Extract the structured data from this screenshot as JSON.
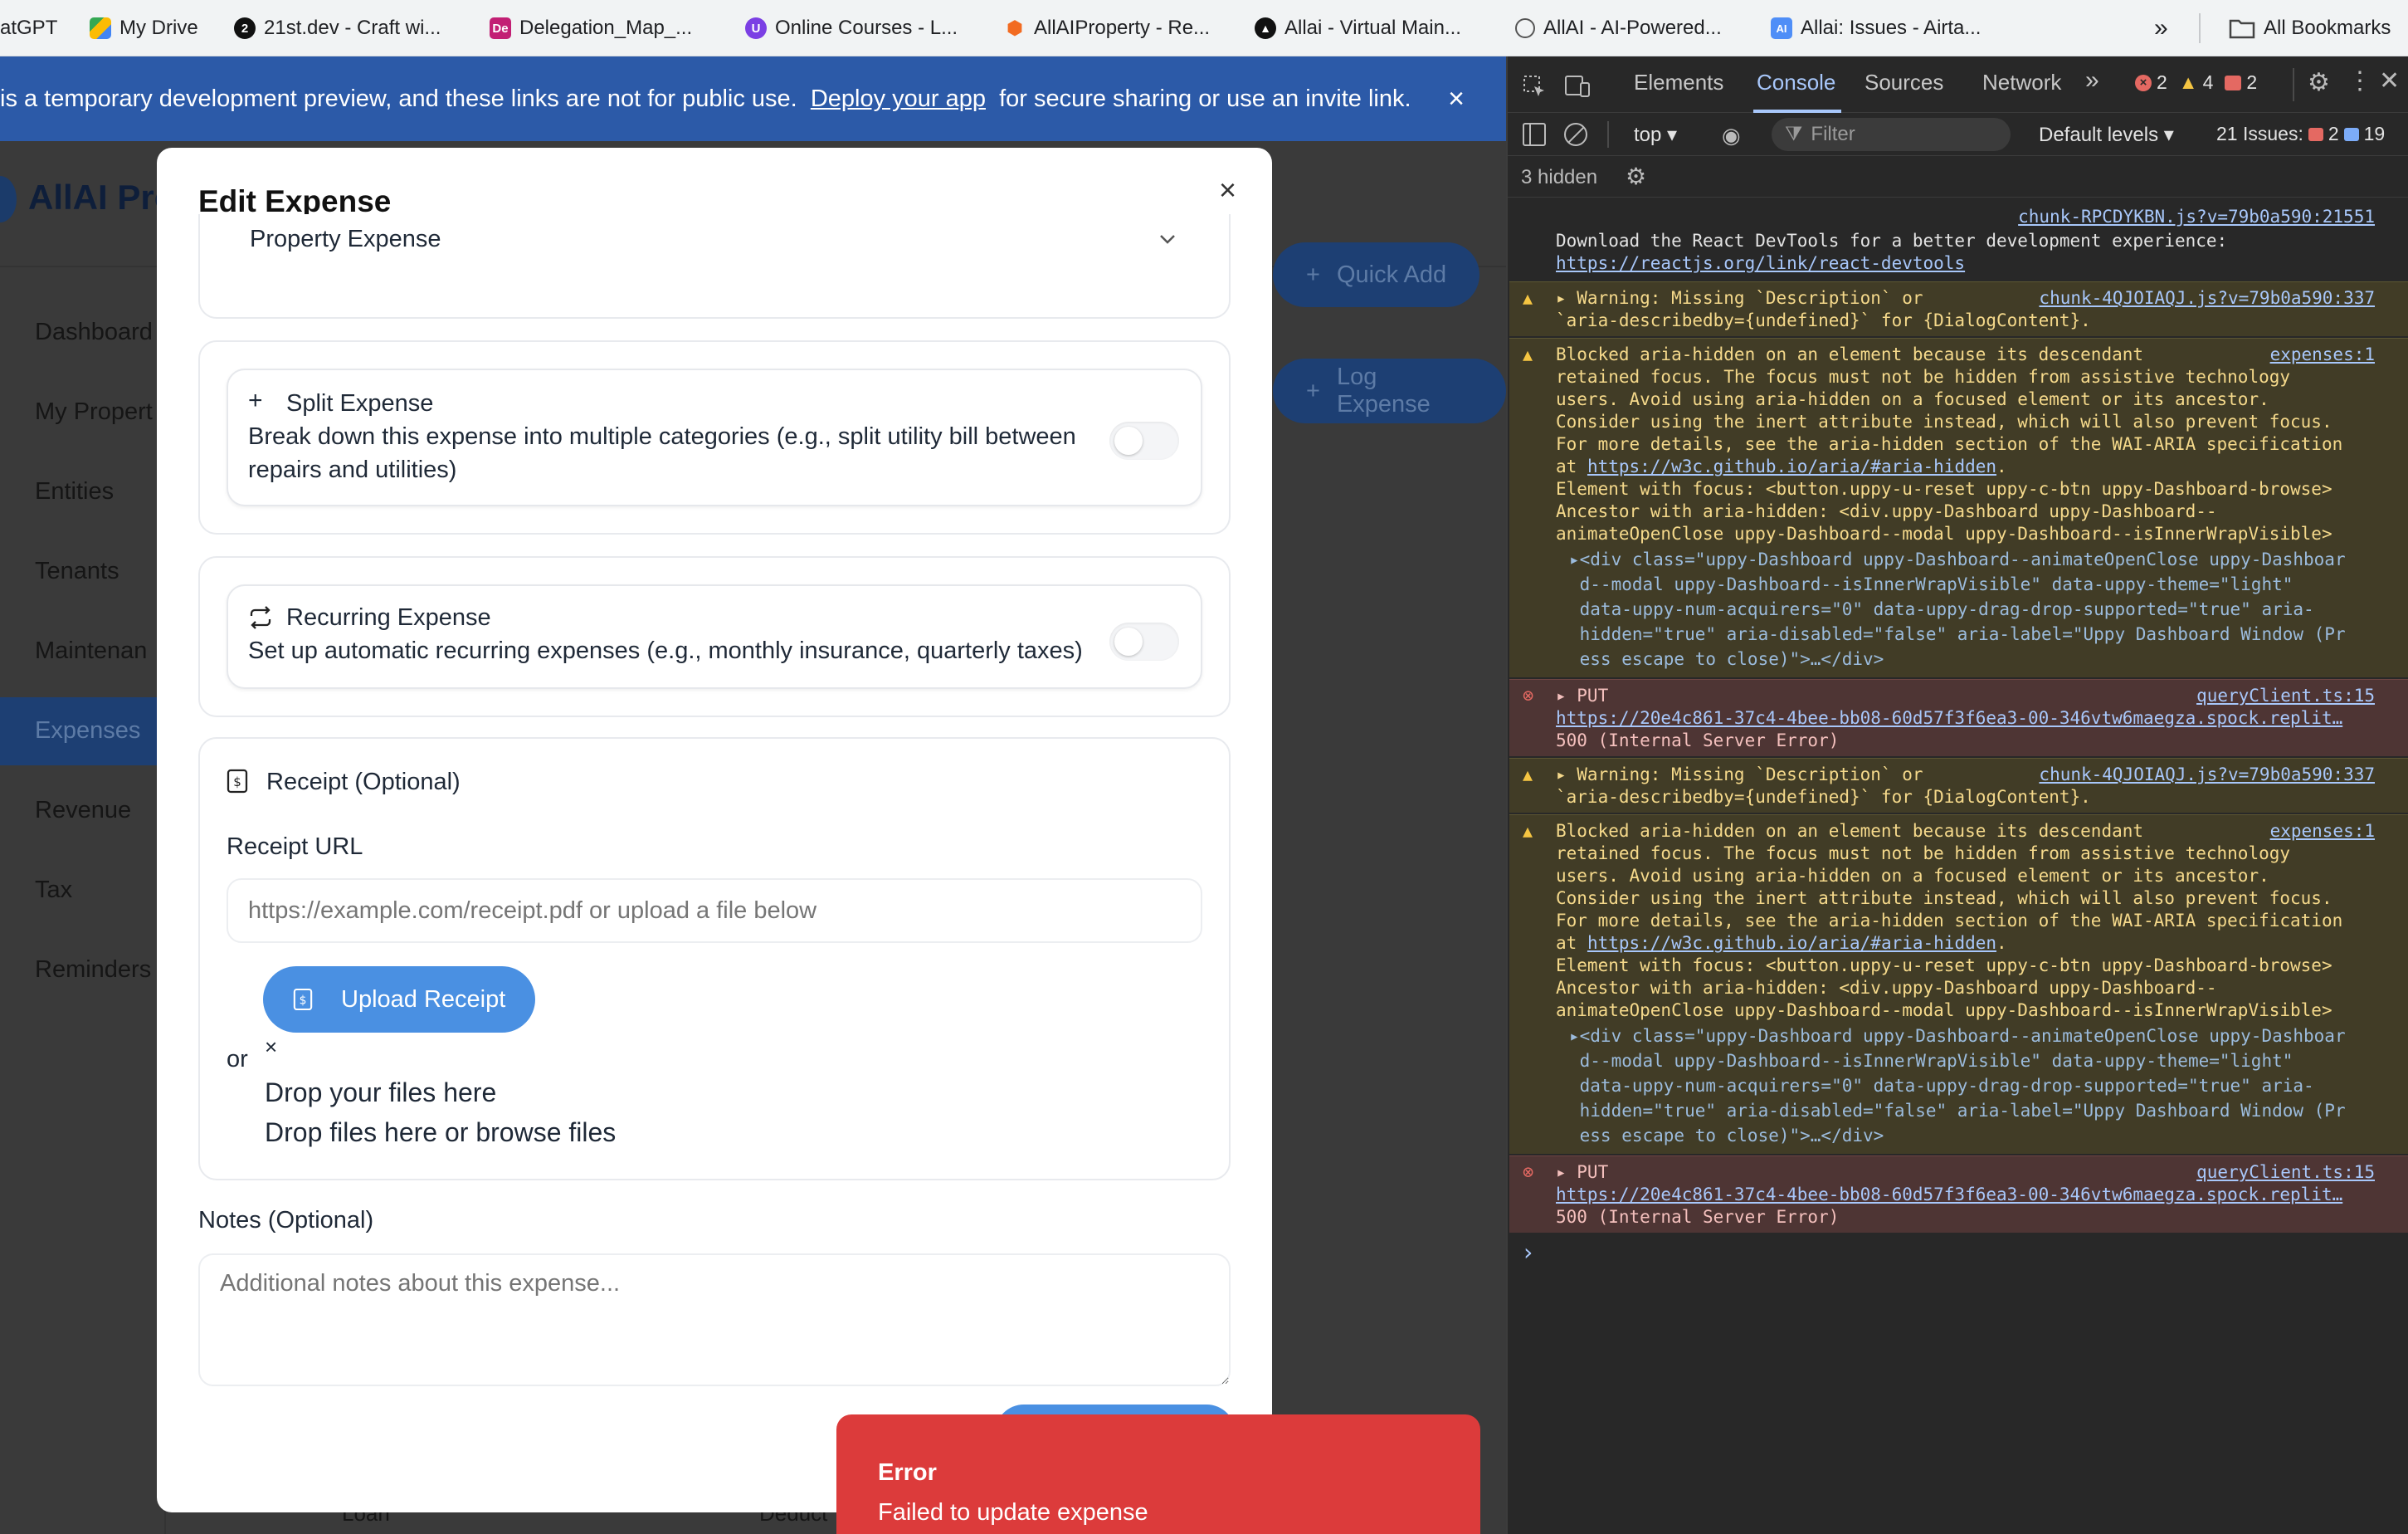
{
  "bookmarks": [
    {
      "label": "ChatGPT",
      "display": "atGPT"
    },
    {
      "label": "My Drive"
    },
    {
      "label": "21st.dev - Craft wi..."
    },
    {
      "label": "Delegation_Map_..."
    },
    {
      "label": "Online Courses - L..."
    },
    {
      "label": "AllAIProperty - Re..."
    },
    {
      "label": "Allai - Virtual Main..."
    },
    {
      "label": "AllAI - AI-Powered..."
    },
    {
      "label": "Allai: Issues - Airta..."
    }
  ],
  "bookmarks_more": "»",
  "all_bookmarks": "All Bookmarks",
  "banner": {
    "prefix": "is a temporary development preview, and these links are not for public use.",
    "link": "Deploy your app",
    "suffix": "for secure sharing or use an invite link.",
    "close": "×"
  },
  "app": {
    "title": "AllAI Pro",
    "quick_add": "Quick Add",
    "log_expense": "Log Expense",
    "nav": [
      "Dashboard",
      "My Propert",
      "Entities",
      "Tenants",
      "Maintenan",
      "Expenses",
      "Revenue",
      "Tax",
      "Reminders"
    ],
    "bottom_left": "Loan",
    "bottom_right": "Deduct"
  },
  "modal": {
    "title": "Edit Expense",
    "close": "×",
    "category_value": "Property Expense",
    "split": {
      "title": "Split Expense",
      "desc_line1": "Break down this expense into multiple categories (e.g., split utility bill between",
      "desc_line2": "repairs and utilities)",
      "enabled": false
    },
    "recurring": {
      "title": "Recurring Expense",
      "desc": "Set up automatic recurring expenses (e.g., monthly insurance, quarterly taxes)",
      "enabled": false
    },
    "receipt": {
      "title": "Receipt (Optional)",
      "url_label": "Receipt URL",
      "url_placeholder": "https://example.com/receipt.pdf or upload a file below",
      "upload_button": "Upload Receipt",
      "or": "or",
      "x": "×",
      "drop1": "Drop your files here",
      "drop2": "Drop files here or browse files"
    },
    "notes": {
      "label": "Notes (Optional)",
      "placeholder": "Additional notes about this expense..."
    }
  },
  "toast": {
    "title": "Error",
    "message": "Failed to update expense"
  },
  "devtools": {
    "tabs": [
      "Elements",
      "Console",
      "Sources",
      "Network"
    ],
    "active_tab": "Console",
    "more": "»",
    "errors": "2",
    "warnings": "4",
    "issues_badge": "2",
    "context": "top",
    "filter_placeholder": "Filter",
    "levels": "Default levels",
    "issues_label": "21 Issues:",
    "issues_err": "2",
    "issues_info": "19",
    "hidden": "3 hidden",
    "messages": [
      {
        "type": "info",
        "source": "chunk-RPCDYKBN.js?v=79b0a590:21551",
        "lines": [
          "Download the React DevTools for a better development experience:"
        ],
        "link": "https://reactjs.org/link/react-devtools"
      },
      {
        "type": "warn",
        "source": "chunk-4QJOIAQJ.js?v=79b0a590:337",
        "lines": [
          "Warning: Missing `Description` or",
          "`aria-describedby={undefined}` for {DialogContent}."
        ]
      },
      {
        "type": "warn",
        "source": "expenses:1",
        "lines": [
          "Blocked aria-hidden on an element because its descendant",
          "retained focus. The focus must not be hidden from assistive technology",
          "users. Avoid using aria-hidden on a focused element or its ancestor.",
          "Consider using the inert attribute instead, which will also prevent focus.",
          "For more details, see the aria-hidden section of the WAI-ARIA specification"
        ],
        "at": "at",
        "at_link": "https://w3c.github.io/aria/#aria-hidden",
        "lines2": [
          "Element with focus: <button.uppy-u-reset uppy-c-btn uppy-Dashboard-browse>",
          "Ancestor with aria-hidden: <div.uppy-Dashboard uppy-Dashboard--",
          "animateOpenClose uppy-Dashboard--modal uppy-Dashboard--isInnerWrapVisible>"
        ],
        "code": [
          "<div class=\"uppy-Dashboard uppy-Dashboard--animateOpenClose uppy-Dashboar",
          "d--modal uppy-Dashboard--isInnerWrapVisible\" data-uppy-theme=\"light\"",
          "data-uppy-num-acquirers=\"0\" data-uppy-drag-drop-supported=\"true\" aria-",
          "hidden=\"true\" aria-disabled=\"false\" aria-label=\"Uppy Dashboard Window (Pr",
          "ess escape to close)\">…</div>"
        ]
      },
      {
        "type": "error",
        "source": "queryClient.ts:15",
        "method": "PUT",
        "url": "https://20e4c861-37c4-4bee-bb08-60d57f3f6ea3-00-346vtw6maegza.spock.replit…",
        "status": "500 (Internal Server Error)"
      },
      {
        "type": "warn",
        "source": "chunk-4QJOIAQJ.js?v=79b0a590:337",
        "lines": [
          "Warning: Missing `Description` or",
          "`aria-describedby={undefined}` for {DialogContent}."
        ]
      },
      {
        "type": "warn",
        "source": "expenses:1",
        "lines": [
          "Blocked aria-hidden on an element because its descendant",
          "retained focus. The focus must not be hidden from assistive technology",
          "users. Avoid using aria-hidden on a focused element or its ancestor.",
          "Consider using the inert attribute instead, which will also prevent focus.",
          "For more details, see the aria-hidden section of the WAI-ARIA specification"
        ],
        "at": "at",
        "at_link": "https://w3c.github.io/aria/#aria-hidden",
        "lines2": [
          "Element with focus: <button.uppy-u-reset uppy-c-btn uppy-Dashboard-browse>",
          "Ancestor with aria-hidden: <div.uppy-Dashboard uppy-Dashboard--",
          "animateOpenClose uppy-Dashboard--modal uppy-Dashboard--isInnerWrapVisible>"
        ],
        "code": [
          "<div class=\"uppy-Dashboard uppy-Dashboard--animateOpenClose uppy-Dashboar",
          "d--modal uppy-Dashboard--isInnerWrapVisible\" data-uppy-theme=\"light\"",
          "data-uppy-num-acquirers=\"0\" data-uppy-drag-drop-supported=\"true\" aria-",
          "hidden=\"true\" aria-disabled=\"false\" aria-label=\"Uppy Dashboard Window (Pr",
          "ess escape to close)\">…</div>"
        ]
      },
      {
        "type": "error",
        "source": "queryClient.ts:15",
        "method": "PUT",
        "url": "https://20e4c861-37c4-4bee-bb08-60d57f3f6ea3-00-346vtw6maegza.spock.replit…",
        "status": "500 (Internal Server Error)"
      }
    ],
    "prompt": "›"
  },
  "colors": {
    "accent": "#4a90e2",
    "banner": "#2c5aa8",
    "error_toast": "#dc3b3b",
    "dev_bg": "#282828"
  }
}
